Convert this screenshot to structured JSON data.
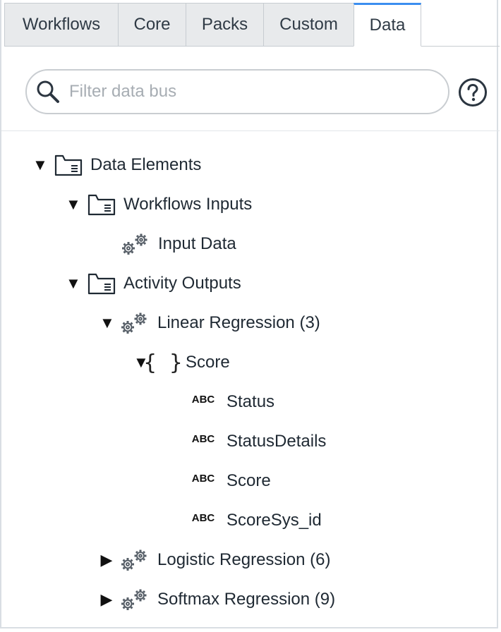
{
  "tabs": [
    {
      "label": "Workflows",
      "active": false
    },
    {
      "label": "Core",
      "active": false
    },
    {
      "label": "Packs",
      "active": false
    },
    {
      "label": "Custom",
      "active": false
    },
    {
      "label": "Data",
      "active": true
    }
  ],
  "search": {
    "placeholder": "Filter data bus",
    "value": ""
  },
  "icons": {
    "search": "search-icon",
    "help": "help-circle-icon",
    "folder": "folder-icon",
    "gear": "gears-icon",
    "object": "braces-icon",
    "string": "abc-icon"
  },
  "colors": {
    "active_tab_accent": "#3b8ef0",
    "tab_background": "#e8eaec"
  },
  "tree": {
    "data_elements": {
      "label": "Data Elements",
      "expanded": true
    },
    "workflows_inputs": {
      "label": "Workflows Inputs",
      "expanded": true
    },
    "input_data": {
      "label": "Input Data"
    },
    "activity_outputs": {
      "label": "Activity Outputs",
      "expanded": true
    },
    "linear_regression": {
      "label": "Linear Regression (3)",
      "expanded": true
    },
    "score_object": {
      "label": "Score",
      "expanded": true
    },
    "fields": [
      {
        "type_label": "ABC",
        "label": "Status"
      },
      {
        "type_label": "ABC",
        "label": "StatusDetails"
      },
      {
        "type_label": "ABC",
        "label": "Score"
      },
      {
        "type_label": "ABC",
        "label": "ScoreSys_id"
      }
    ],
    "logistic_regression": {
      "label": "Logistic Regression (6)",
      "expanded": false
    },
    "softmax_regression": {
      "label": "Softmax Regression (9)",
      "expanded": false
    },
    "expanded_glyph": "▼",
    "collapsed_glyph": "▶",
    "brace_glyph": "{ }"
  }
}
